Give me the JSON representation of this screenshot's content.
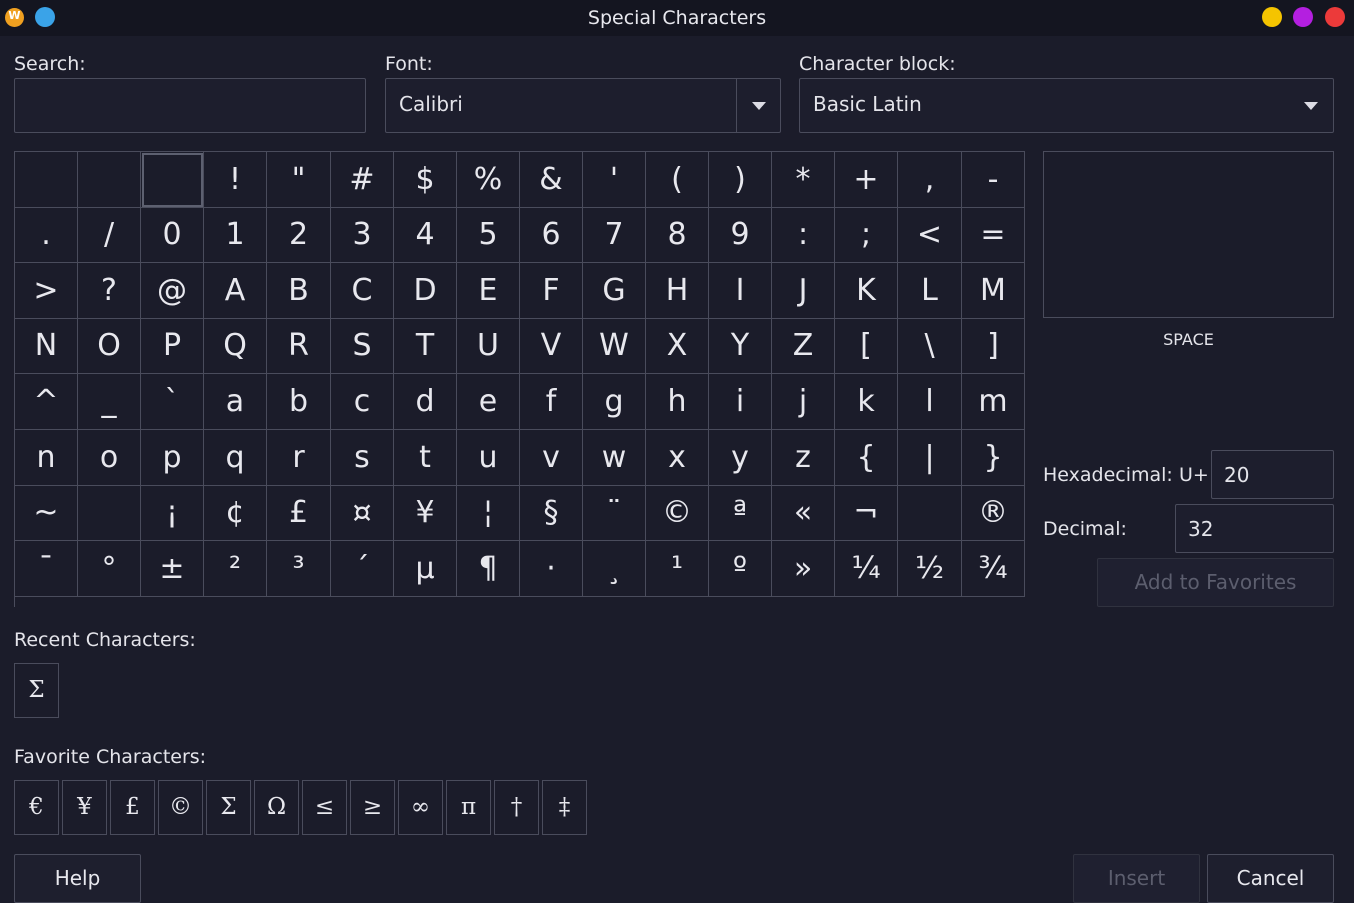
{
  "window": {
    "title": "Special Characters",
    "app_icon": "writer-icon",
    "controls": [
      "minimize-icon",
      "maximize-icon",
      "close-icon"
    ]
  },
  "search": {
    "label": "Search:",
    "value": ""
  },
  "font": {
    "label": "Font:",
    "value": "Calibri"
  },
  "block": {
    "label": "Character block:",
    "value": "Basic Latin"
  },
  "grid": {
    "columns": 16,
    "selected_index": 2,
    "rows": [
      [
        "",
        "",
        "",
        "!",
        "\"",
        "#",
        "$",
        "%",
        "&",
        "'",
        "(",
        ")",
        "*",
        "+",
        ",",
        "-"
      ],
      [
        ".",
        "/",
        "0",
        "1",
        "2",
        "3",
        "4",
        "5",
        "6",
        "7",
        "8",
        "9",
        ":",
        ";",
        "<",
        "="
      ],
      [
        ">",
        "?",
        "@",
        "A",
        "B",
        "C",
        "D",
        "E",
        "F",
        "G",
        "H",
        "I",
        "J",
        "K",
        "L",
        "M"
      ],
      [
        "N",
        "O",
        "P",
        "Q",
        "R",
        "S",
        "T",
        "U",
        "V",
        "W",
        "X",
        "Y",
        "Z",
        "[",
        "\\",
        "]"
      ],
      [
        "^",
        "_",
        "`",
        "a",
        "b",
        "c",
        "d",
        "e",
        "f",
        "g",
        "h",
        "i",
        "j",
        "k",
        "l",
        "m"
      ],
      [
        "n",
        "o",
        "p",
        "q",
        "r",
        "s",
        "t",
        "u",
        "v",
        "w",
        "x",
        "y",
        "z",
        "{",
        "|",
        "}"
      ],
      [
        "~",
        "",
        "¡",
        "¢",
        "£",
        "¤",
        "¥",
        "¦",
        "§",
        "¨",
        "©",
        "ª",
        "«",
        "¬",
        "",
        "®"
      ],
      [
        "¯",
        "°",
        "±",
        "²",
        "³",
        "´",
        "µ",
        "¶",
        "·",
        "¸",
        "¹",
        "º",
        "»",
        "¼",
        "½",
        "¾"
      ]
    ]
  },
  "preview": {
    "char_name": "SPACE"
  },
  "hex": {
    "label": "Hexadecimal:",
    "prefix": "U+",
    "value": "20"
  },
  "decimal": {
    "label": "Decimal:",
    "value": "32"
  },
  "add_favorites_label": "Add to Favorites",
  "recent": {
    "label": "Recent Characters:",
    "chars": [
      "Σ"
    ]
  },
  "favorites": {
    "label": "Favorite Characters:",
    "chars": [
      "€",
      "¥",
      "£",
      "©",
      "Σ",
      "Ω",
      "≤",
      "≥",
      "∞",
      "π",
      "†",
      "‡"
    ]
  },
  "buttons": {
    "help": "Help",
    "insert": "Insert",
    "cancel": "Cancel"
  },
  "colors": {
    "background": "#1b1c2a",
    "titlebar": "#141520",
    "border": "#4a4c5c",
    "minimize": "#f5c400",
    "maximize": "#b41fe0",
    "close": "#ec3a3a"
  }
}
